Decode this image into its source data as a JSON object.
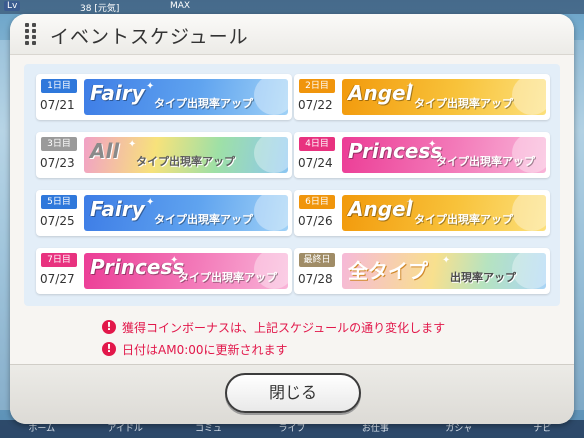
{
  "background": {
    "level_badge": "Lv",
    "stamina": "38 [元気]",
    "max_label": "MAX",
    "nav": [
      "ホーム",
      "アイドル",
      "コミュ",
      "ライブ",
      "お仕事",
      "ガシャ",
      "ナビ"
    ]
  },
  "dialog": {
    "title": "イベントスケジュール",
    "schedule": [
      {
        "day": "1日目",
        "date": "07/21",
        "type": "Fairy",
        "suffix": "タイプ出現率アップ",
        "style": "fairy",
        "badge_color": "#2f78db"
      },
      {
        "day": "2日目",
        "date": "07/22",
        "type": "Angel",
        "suffix": "タイプ出現率アップ",
        "style": "angel",
        "badge_color": "#f0950c"
      },
      {
        "day": "3日目",
        "date": "07/23",
        "type": "All",
        "suffix": "タイプ出現率アップ",
        "style": "all",
        "badge_color": "#9a9a9a"
      },
      {
        "day": "4日目",
        "date": "07/24",
        "type": "Princess",
        "suffix": "タイプ出現率アップ",
        "style": "princess",
        "badge_color": "#e8327f"
      },
      {
        "day": "5日目",
        "date": "07/25",
        "type": "Fairy",
        "suffix": "タイプ出現率アップ",
        "style": "fairy",
        "badge_color": "#2f78db"
      },
      {
        "day": "6日目",
        "date": "07/26",
        "type": "Angel",
        "suffix": "タイプ出現率アップ",
        "style": "angel",
        "badge_color": "#f0950c"
      },
      {
        "day": "7日目",
        "date": "07/27",
        "type": "Princess",
        "suffix": "タイプ出現率アップ",
        "style": "princess",
        "badge_color": "#e8327f"
      },
      {
        "day": "最終日",
        "date": "07/28",
        "type": "全タイプ",
        "suffix": "出現率アップ",
        "style": "final",
        "badge_color": "#a08c66"
      }
    ],
    "notes": [
      {
        "icon": "warning-icon",
        "text": "獲得コインボーナスは、上記スケジュールの通り変化します"
      },
      {
        "icon": "warning-icon",
        "text": "日付はAM0:00に更新されます"
      }
    ],
    "close_label": "閉じる"
  },
  "colors": {
    "accent_warning": "#e2174a",
    "panel_bg": "#e3eef8",
    "dialog_bg": "#f7f5f2"
  }
}
